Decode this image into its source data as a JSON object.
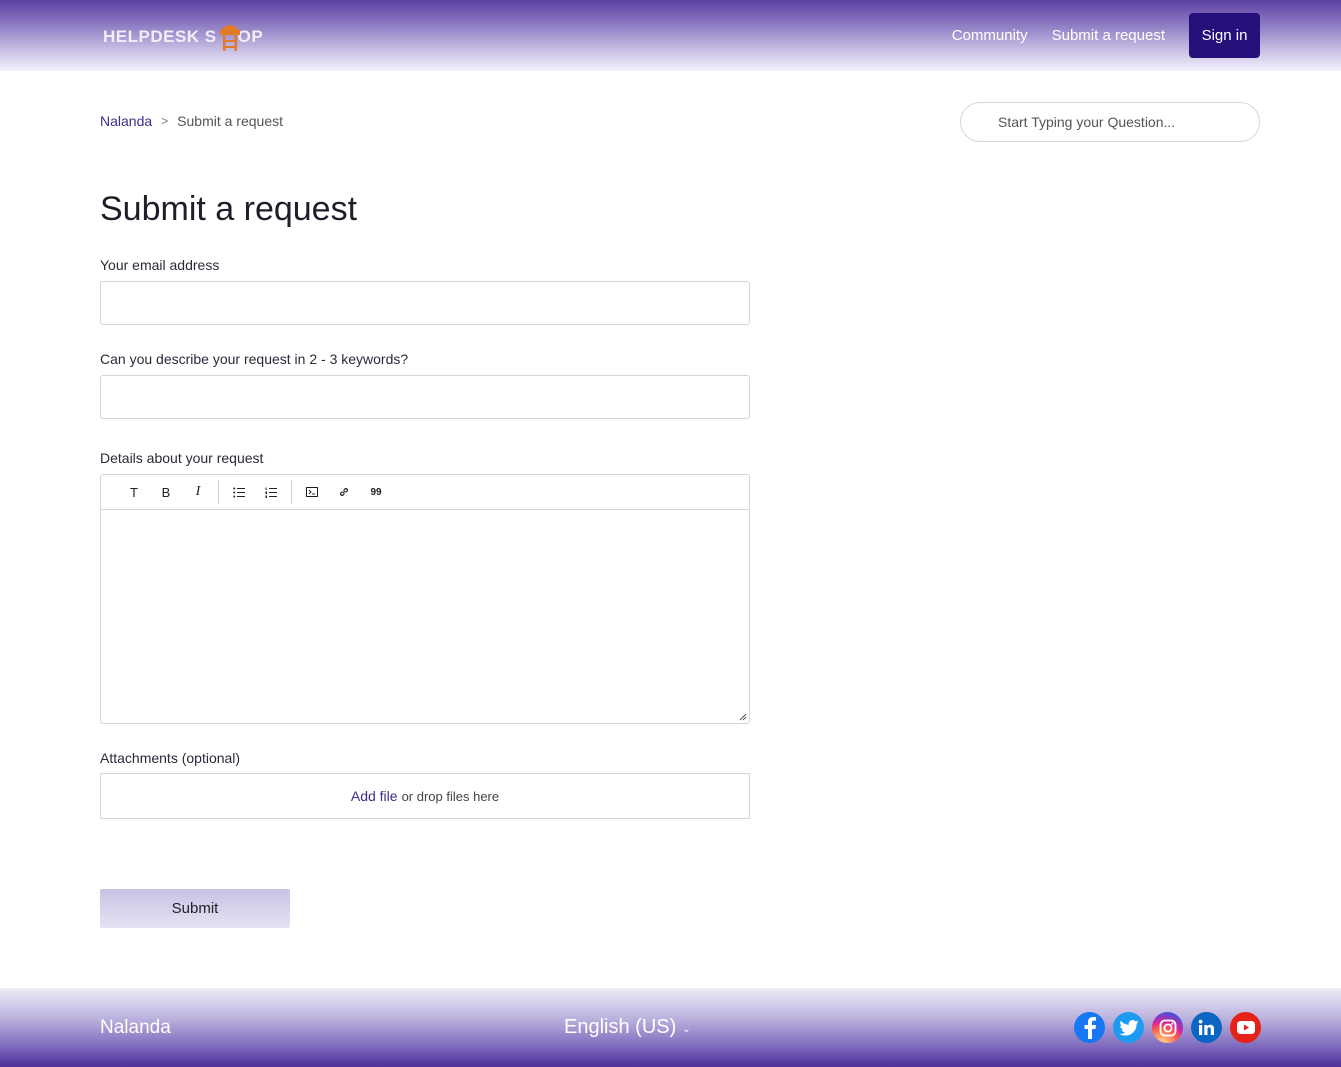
{
  "header": {
    "logo_text_left": "HELPDESK S",
    "logo_text_right": "OP",
    "nav": [
      {
        "label": "Community"
      },
      {
        "label": "Submit a request"
      }
    ],
    "sign_in": "Sign in"
  },
  "breadcrumb": {
    "root": "Nalanda",
    "separator": ">",
    "current": "Submit a request"
  },
  "search": {
    "placeholder": "Start Typing your Question..."
  },
  "form": {
    "title": "Submit a request",
    "email_label": "Your email address",
    "email_value": "",
    "keywords_label": "Can you describe your request in 2 - 3 keywords?",
    "keywords_value": "",
    "details_label": "Details about your request",
    "toolbar": [
      {
        "icon": "text-format-icon",
        "glyph": "T"
      },
      {
        "icon": "bold-icon",
        "glyph": "B"
      },
      {
        "icon": "italic-icon",
        "glyph": "I"
      },
      {
        "icon": "bulleted-list-icon"
      },
      {
        "icon": "numbered-list-icon"
      },
      {
        "icon": "code-block-icon"
      },
      {
        "icon": "link-icon"
      },
      {
        "icon": "quote-icon",
        "glyph": "99"
      }
    ],
    "attachments_label": "Attachments (optional)",
    "add_file": "Add file",
    "drop_text": "or drop files here",
    "submit": "Submit"
  },
  "footer": {
    "brand": "Nalanda",
    "language": "English (US)",
    "social": [
      "facebook-icon",
      "twitter-icon",
      "instagram-icon",
      "linkedin-icon",
      "youtube-icon"
    ]
  },
  "colors": {
    "accent": "#25107a",
    "link": "#3b2f8a",
    "logo_orange": "#e07b2a"
  }
}
